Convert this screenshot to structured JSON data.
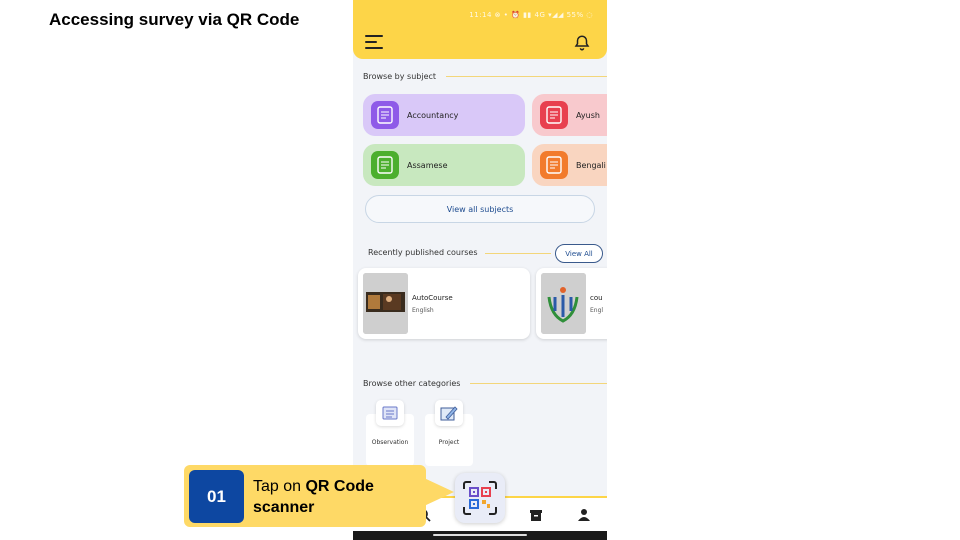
{
  "slide": {
    "title": "Accessing survey via QR Code"
  },
  "app": {
    "status_text": "11:14 ⊗ •  ⏰ ▮▮ 4G ▾◢◢ 55% ◌",
    "header": {
      "menu_icon": "hamburger-menu-icon",
      "bell_icon": "bell-icon",
      "bg_color": "#fdd548"
    },
    "browse_by_subject": {
      "heading": "Browse by subject",
      "subjects": [
        {
          "label": "Accountancy",
          "bg": "#d9c8f8",
          "icon_bg": "#8e5be8"
        },
        {
          "label": "Ayush",
          "bg": "#f8c9cd",
          "icon_bg": "#e8404f"
        },
        {
          "label": "Assamese",
          "bg": "#c8e8bf",
          "icon_bg": "#4caf2e"
        },
        {
          "label": "Bengali",
          "bg": "#f9d5c0",
          "icon_bg": "#f27b2c"
        }
      ],
      "view_all_label": "View all subjects"
    },
    "recent_courses": {
      "heading": "Recently published courses",
      "view_all_label": "View All",
      "courses": [
        {
          "title": "AutoCourse",
          "language": "English"
        },
        {
          "title": "cou",
          "language": "Engl"
        }
      ]
    },
    "other_categories": {
      "heading": "Browse other categories",
      "items": [
        {
          "label": "Observation",
          "icon": "observation-list-icon"
        },
        {
          "label": "Project",
          "icon": "project-edit-icon"
        }
      ]
    },
    "bottom_nav": {
      "qr_icon": "qr-code-scanner-icon",
      "items": [
        "search-icon",
        "archive-icon",
        "profile-icon"
      ]
    }
  },
  "callout": {
    "step_number": "01",
    "text_prefix": "Tap on ",
    "text_bold": "QR Code scanner",
    "box_color": "#fed966",
    "number_bg": "#0d47a1"
  }
}
